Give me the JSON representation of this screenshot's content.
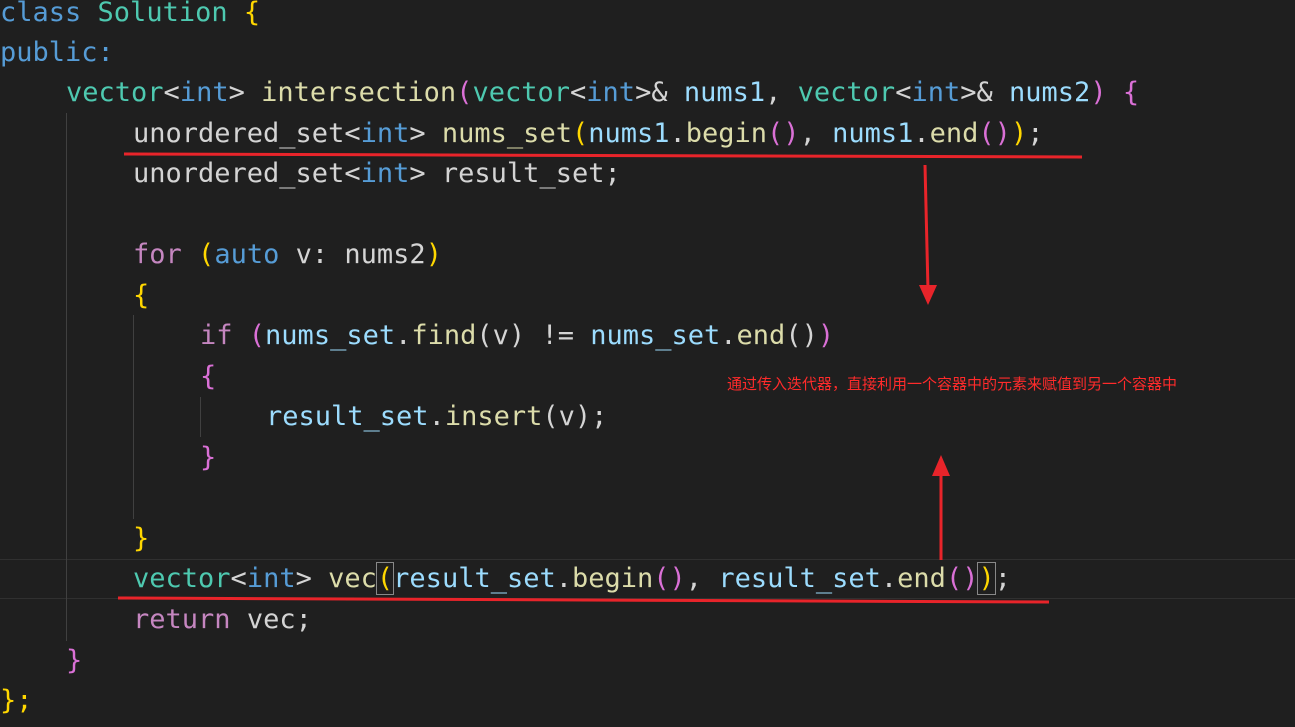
{
  "code": {
    "l1": {
      "class_kw": "class",
      "class_name": "Solution",
      "brace": "{"
    },
    "l2": {
      "access": "public:"
    },
    "l3": {
      "ret_type": "vector",
      "lt": "<",
      "int": "int",
      "gt": ">",
      "fn": "intersection",
      "lp": "(",
      "p1_type": "vector",
      "p1_lt": "<",
      "p1_int": "int",
      "p1_gt": ">&",
      "p1_name": "nums1",
      "comma": ",",
      "p2_type": "vector",
      "p2_lt": "<",
      "p2_int": "int",
      "p2_gt": ">&",
      "p2_name": "nums2",
      "rp": ")",
      "brace": "{"
    },
    "l4": {
      "type": "unordered_set",
      "lt": "<",
      "int": "int",
      "gt": ">",
      "name": "nums_set",
      "lp": "(",
      "a1": "nums1",
      "dot1": ".",
      "m1": "begin",
      "c1": "()",
      "comma": ",",
      "a2": "nums1",
      "dot2": ".",
      "m2": "end",
      "c2": "()",
      "rp": ")",
      "semi": ";"
    },
    "l5": {
      "type": "unordered_set",
      "lt": "<",
      "int": "int",
      "gt": ">",
      "name": "result_set",
      "semi": ";"
    },
    "l7": {
      "for": "for",
      "lp": "(",
      "auto": "auto",
      "v": "v",
      "colon": ":",
      "nums2": "nums2",
      "rp": ")"
    },
    "l8": {
      "brace": "{"
    },
    "l9": {
      "if": "if",
      "lp": "(",
      "obj": "nums_set",
      "dot": ".",
      "find": "find",
      "args": "(v)",
      "ne": "!=",
      "obj2": "nums_set",
      "dot2": ".",
      "end": "end",
      "call": "()",
      "rp": ")"
    },
    "l10": {
      "brace": "{"
    },
    "l11": {
      "obj": "result_set",
      "dot": ".",
      "insert": "insert",
      "args": "(v)",
      "semi": ";"
    },
    "l12": {
      "brace": "}"
    },
    "l14": {
      "brace": "}"
    },
    "l15": {
      "type": "vector",
      "lt": "<",
      "int": "int",
      "gt": ">",
      "name": "vec",
      "lp": "(",
      "a1": "result_set",
      "dot1": ".",
      "m1": "begin",
      "c1": "()",
      "comma": ",",
      "a2": "result_set",
      "dot2": ".",
      "m2": "end",
      "c2": "()",
      "rp": ")",
      "semi": ";"
    },
    "l16": {
      "ret": "return",
      "name": "vec",
      "semi": ";"
    },
    "l17": {
      "brace": "}"
    },
    "l18": {
      "brace": "};"
    }
  },
  "annotation": {
    "text": "通过传入迭代器，直接利用一个容器中的元素来赋值到另一个容器中"
  },
  "colors": {
    "annotation_red": "#e8242a",
    "keyword": "#569cd6",
    "control": "#c586c0",
    "type": "#4ec9b0",
    "function": "#dcdcaa",
    "variable": "#9cdcfe"
  }
}
